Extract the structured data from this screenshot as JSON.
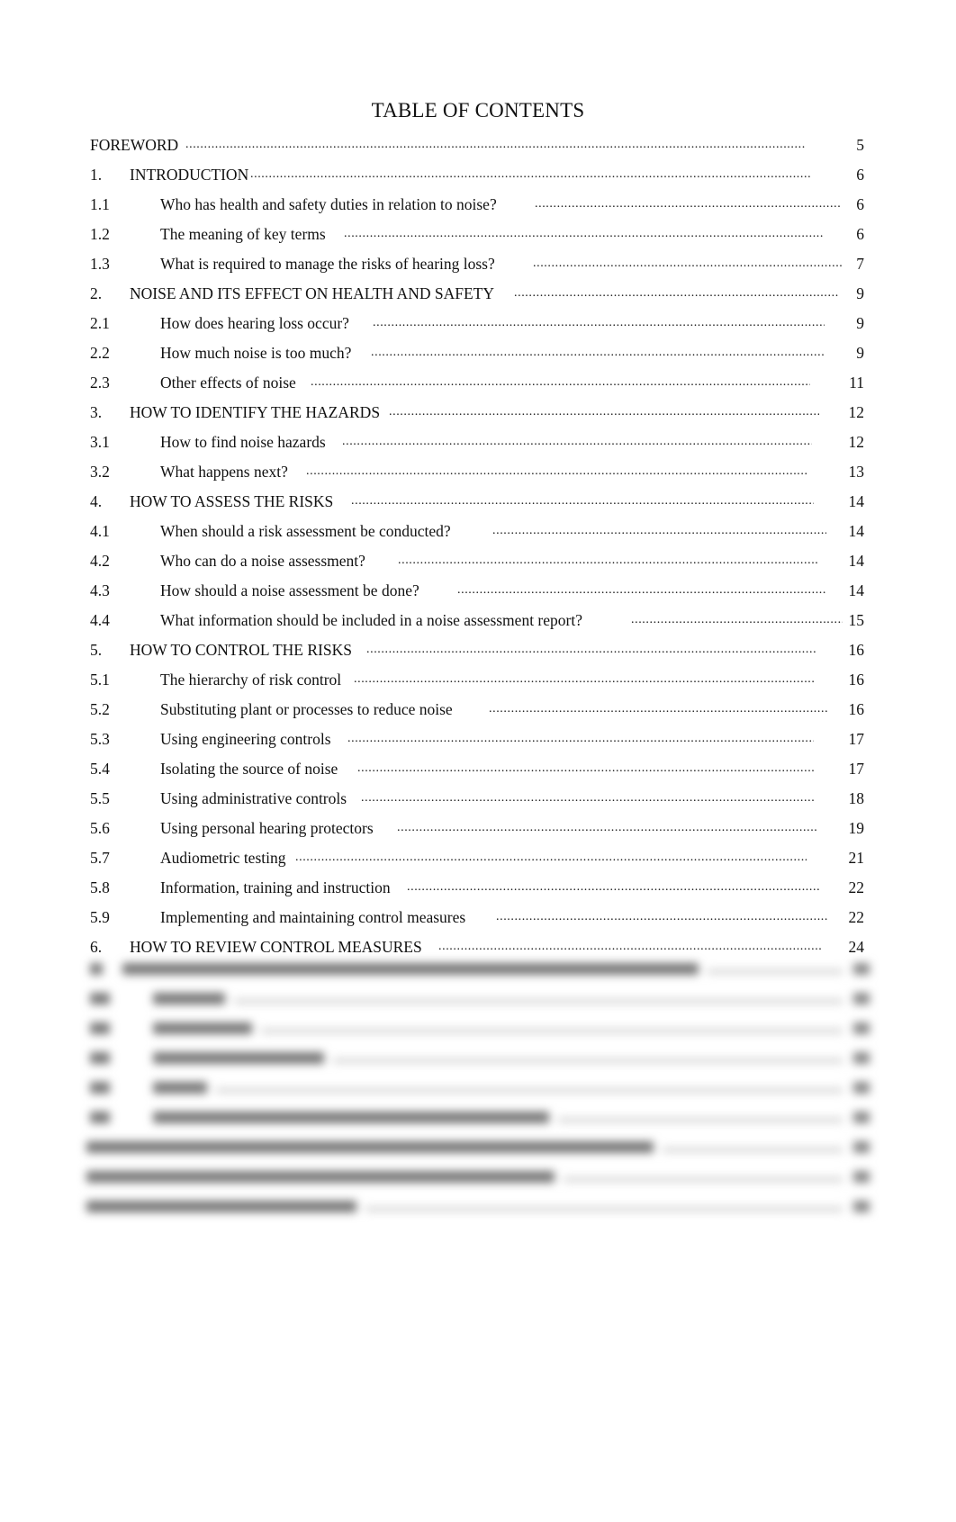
{
  "document": {
    "title": "TABLE OF CONTENTS",
    "entries": [
      {
        "num": "",
        "text": "FOREWORD",
        "page": "5",
        "level": "front"
      },
      {
        "num": "1.",
        "text": "INTRODUCTION",
        "page": "6",
        "level": "chapter"
      },
      {
        "num": "1.1",
        "text": "Who has health and safety duties in relation to noise?",
        "page": "6",
        "level": "section"
      },
      {
        "num": "1.2",
        "text": "The meaning of key terms",
        "page": "6",
        "level": "section"
      },
      {
        "num": "1.3",
        "text": "What is required to manage the risks of hearing loss?",
        "page": "7",
        "level": "section"
      },
      {
        "num": "2.",
        "text": "NOISE AND ITS EFFECT ON HEALTH AND SAFETY",
        "page": "9",
        "level": "chapter"
      },
      {
        "num": "2.1",
        "text": "How does hearing loss occur?",
        "page": "9",
        "level": "section"
      },
      {
        "num": "2.2",
        "text": "How much noise is too much?",
        "page": "9",
        "level": "section"
      },
      {
        "num": "2.3",
        "text": "Other effects of noise",
        "page": "11",
        "level": "section"
      },
      {
        "num": "3.",
        "text": "HOW TO IDENTIFY THE HAZARDS",
        "page": "12",
        "level": "chapter"
      },
      {
        "num": "3.1",
        "text": "How to find noise hazards",
        "page": "12",
        "level": "section"
      },
      {
        "num": "3.2",
        "text": "What happens next?",
        "page": "13",
        "level": "section"
      },
      {
        "num": "4.",
        "text": "HOW TO ASSESS THE RISKS",
        "page": "14",
        "level": "chapter"
      },
      {
        "num": "4.1",
        "text": "When should a risk assessment be conducted?",
        "page": "14",
        "level": "section"
      },
      {
        "num": "4.2",
        "text": "Who can do a noise assessment?",
        "page": "14",
        "level": "section"
      },
      {
        "num": "4.3",
        "text": "How should a noise assessment be done?",
        "page": "14",
        "level": "section"
      },
      {
        "num": "4.4",
        "text": "What information should be included in a noise assessment report?",
        "page": "15",
        "level": "section"
      },
      {
        "num": "5.",
        "text": "HOW TO CONTROL THE RISKS",
        "page": "16",
        "level": "chapter"
      },
      {
        "num": "5.1",
        "text": "The hierarchy of risk control",
        "page": "16",
        "level": "section"
      },
      {
        "num": "5.2",
        "text": "Substituting plant or processes to reduce noise",
        "page": "16",
        "level": "section"
      },
      {
        "num": "5.3",
        "text": "Using engineering controls",
        "page": "17",
        "level": "section"
      },
      {
        "num": "5.4",
        "text": "Isolating the source of noise",
        "page": "17",
        "level": "section"
      },
      {
        "num": "5.5",
        "text": "Using administrative controls",
        "page": "18",
        "level": "section"
      },
      {
        "num": "5.6",
        "text": "Using personal hearing protectors",
        "page": "19",
        "level": "section"
      },
      {
        "num": "5.7",
        "text": "Audiometric testing",
        "page": "21",
        "level": "section"
      },
      {
        "num": "5.8",
        "text": "Information, training and instruction",
        "page": "22",
        "level": "section"
      },
      {
        "num": "5.9",
        "text": "Implementing and maintaining control measures",
        "page": "22",
        "level": "section"
      },
      {
        "num": "6.",
        "text": "HOW TO REVIEW CONTROL MEASURES",
        "page": "24",
        "level": "chapter"
      }
    ],
    "leader_char": ".",
    "blurred_entries_count": 9
  }
}
